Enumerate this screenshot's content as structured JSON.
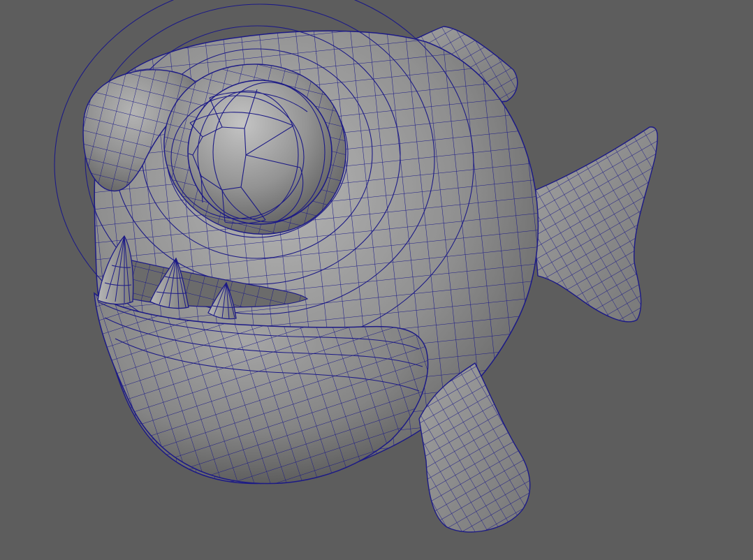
{
  "viewport": {
    "background_color": "#5d5d5d",
    "model_color": "#8f8f8f",
    "wireframe_color": "#1c1a86",
    "shading": "smooth-shaded-with-wireframe"
  }
}
